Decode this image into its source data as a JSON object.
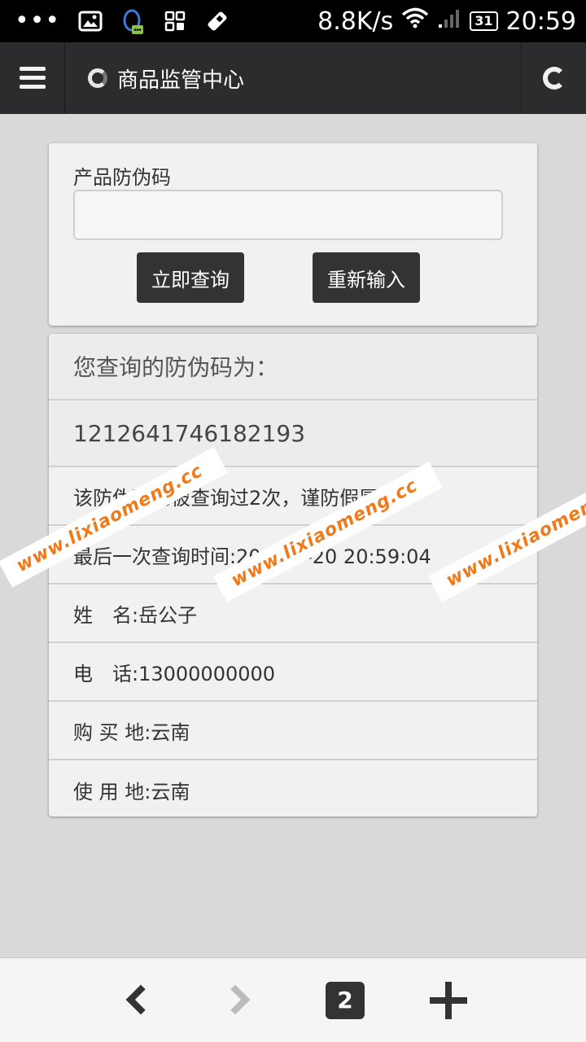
{
  "status_bar": {
    "dots": "•••",
    "icons": [
      "gallery-icon",
      "qq-icon",
      "apps-icon",
      "clean-icon"
    ],
    "net_speed": "8.8K/s",
    "battery": "31",
    "time": "20:59"
  },
  "header": {
    "title": "商品监管中心"
  },
  "form": {
    "label": "产品防伪码",
    "input_value": "",
    "query_button": "立即查询",
    "reset_button": "重新输入"
  },
  "result": {
    "heading": "您查询的防伪码为：",
    "code": "1212641746182193",
    "message": "该防伪码已被查询过2次，谨防假冒!",
    "last_query": "最后一次查询时间:2014-7-20 20:59:04",
    "name": "姓　名:岳公子",
    "phone": "电　话:13000000000",
    "purchase_place": "购 买 地:云南",
    "use_place": "使 用 地:云南"
  },
  "watermark": {
    "text": "www.lixiaomeng.cc",
    "color": "#f07a1a"
  },
  "bottom_nav": {
    "tab_count": "2"
  }
}
